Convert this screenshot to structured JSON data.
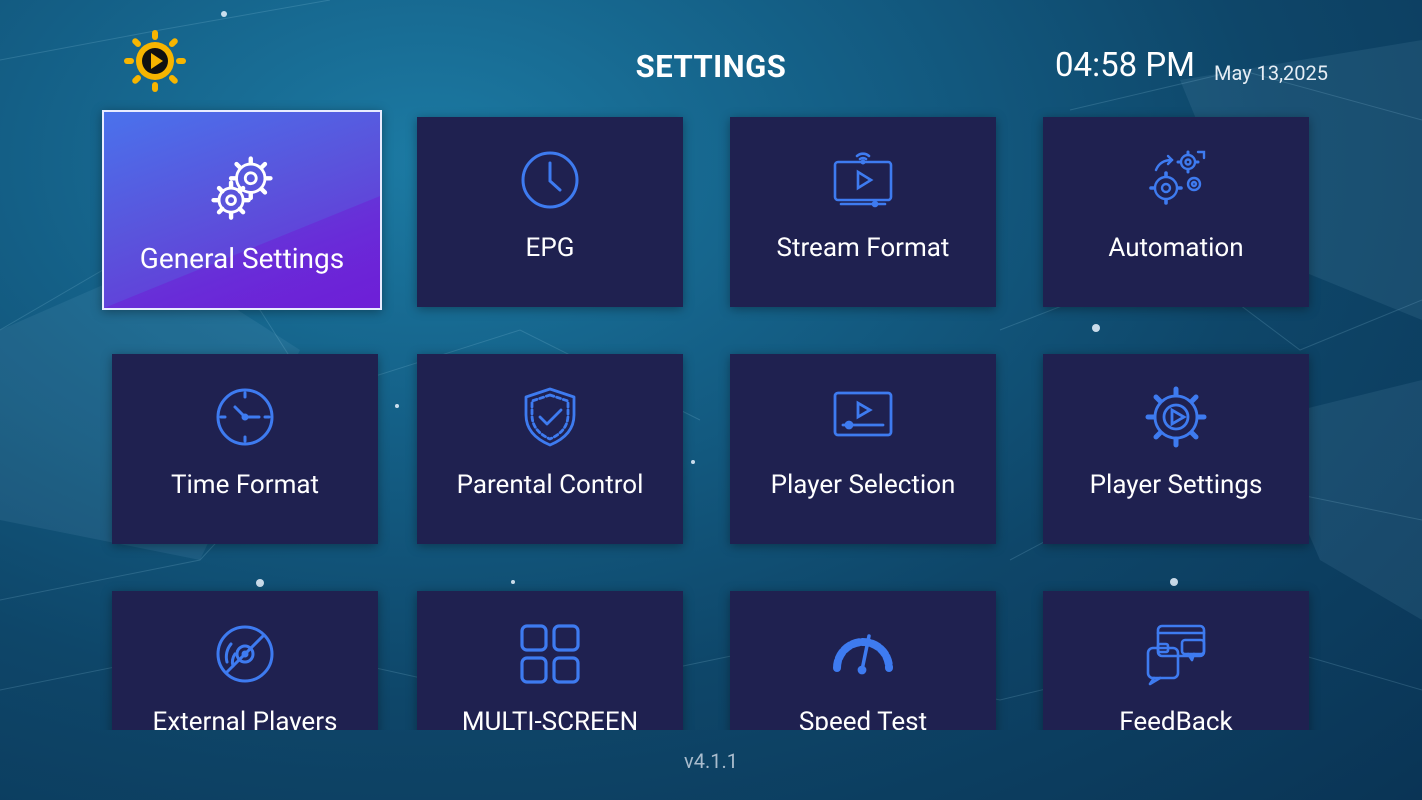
{
  "header": {
    "logo_icon": "sun-play-logo",
    "title": "SETTINGS",
    "time": "04:58 PM",
    "date": "May 13,2025"
  },
  "tiles": [
    {
      "label": "General Settings",
      "icon": "gears-icon",
      "focused": true
    },
    {
      "label": "EPG",
      "icon": "clock-icon"
    },
    {
      "label": "Stream Format",
      "icon": "stream-tv-icon"
    },
    {
      "label": "Automation",
      "icon": "automation-gears-icon"
    },
    {
      "label": "Time Format",
      "icon": "time-clock-icon"
    },
    {
      "label": "Parental Control",
      "icon": "shield-check-icon"
    },
    {
      "label": "Player Selection",
      "icon": "player-screen-icon"
    },
    {
      "label": "Player Settings",
      "icon": "play-gear-icon"
    },
    {
      "label": "External Players",
      "icon": "disc-icon"
    },
    {
      "label": "MULTI-SCREEN",
      "icon": "grid-icon"
    },
    {
      "label": "Speed Test",
      "icon": "speedometer-icon"
    },
    {
      "label": "FeedBack",
      "icon": "chat-bubbles-icon"
    }
  ],
  "footer": {
    "version": "v4.1.1"
  },
  "colors": {
    "tile_bg": "#1f2150",
    "icon_blue": "#3e7bf0",
    "focus_start": "#4a72ec",
    "focus_end": "#6a2ad6",
    "logo_yellow": "#f7b500"
  }
}
